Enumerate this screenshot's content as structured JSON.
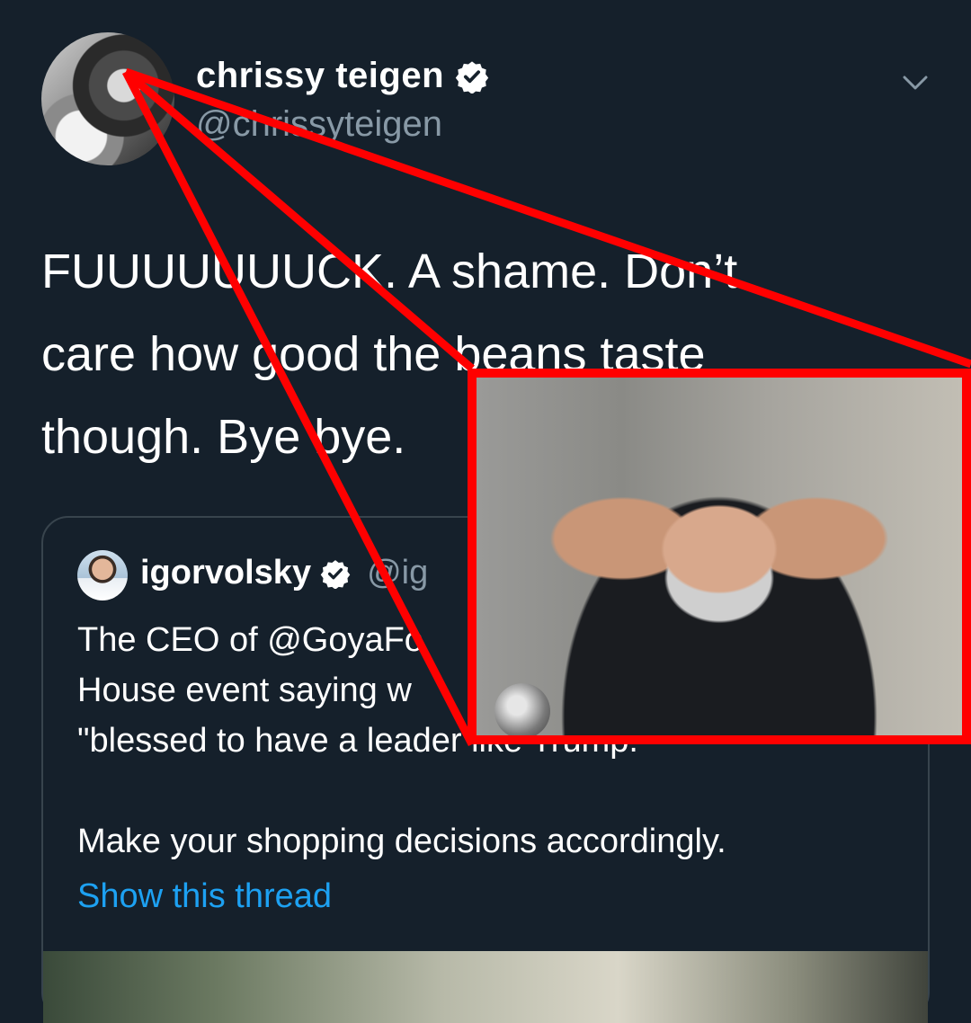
{
  "tweet": {
    "display_name": "chrissy teigen",
    "handle": "@chrissyteigen",
    "text_lines": [
      "FUUUUUUUCK. A shame. Don’t",
      "care how good the beans taste",
      "though. Bye bye."
    ]
  },
  "quoted_tweet": {
    "display_name": "igorvolsky",
    "handle": "@ig",
    "text_lines": [
      "The CEO of @GoyaFo",
      "House event saying w",
      "\"blessed to have a leader like Trump.\"",
      "",
      "Make your shopping decisions accordingly."
    ],
    "show_thread": "Show this thread"
  },
  "icons": {
    "verified": "verified-badge-icon",
    "menu": "chevron-down-icon"
  },
  "colors": {
    "background": "#15202b",
    "secondary_text": "#8899a6",
    "link": "#1da1f2",
    "annotation": "#ff0000"
  }
}
